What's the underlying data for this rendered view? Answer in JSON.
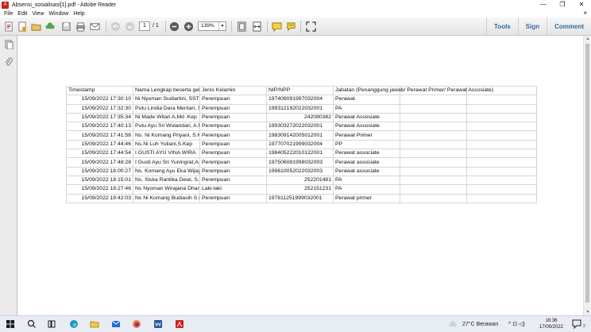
{
  "window": {
    "title": "Absensi_sosialisasi[1].pdf - Adobe Reader",
    "controls": {
      "minimize": "—",
      "maximize": "❐",
      "close": "✕"
    }
  },
  "menu": {
    "items": [
      "File",
      "Edit",
      "View",
      "Window",
      "Help"
    ],
    "close_doc": "×"
  },
  "toolbar": {
    "page_current": "1",
    "page_total": "/ 1",
    "zoom": "139%",
    "nav_links": [
      "Tools",
      "Sign",
      "Comment"
    ]
  },
  "table": {
    "headers": [
      "Timestamp",
      "Nama Lengkap beserta gelar",
      "Jenis Kelamin",
      "NIP/NPP",
      "Jabatan (Penanggung jawab/ Perawat Primer/ Perawat Assosiate)"
    ],
    "rows": [
      [
        "15/09/2022 17:30:10",
        "Ni Nyoman Sudiartini, SST",
        "Perempuan",
        "197409091997032004",
        "Perawat"
      ],
      [
        "15/09/2022 17:32:30",
        "Putu Lindia Dara Mentari, S.Kep",
        "Perempuan",
        "199312192022032001",
        "PA"
      ],
      [
        "15/09/2022 17:35:34",
        "Ni Made Witari A,Md .Kep",
        "Perempuan",
        "242080382",
        "Perawat Assosiate"
      ],
      [
        "15/09/2022 17:40:13",
        "Putu Ayu Sri Wulandari, A.Md.Kep",
        "Perempuan",
        "199303272022032001",
        "Perawat Assosiate"
      ],
      [
        "15/09/2022 17:41:58",
        "Ns. Ni Komang Priyani, S.Kep",
        "Perempuan",
        "198309142005012001",
        "Perawat Primer"
      ],
      [
        "15/09/2022 17:44:46",
        "Ns.Ni Luh Yuliani,S.Kep",
        "Perempuan",
        "197707021999032004",
        "PP"
      ],
      [
        "15/09/2022 17:44:54",
        "I GUSTI AYU VINA WIRA",
        "Perempuan",
        "198405222010122001",
        "Perawat associate"
      ],
      [
        "15/09/2022 17:48:28",
        "I Gusti Ayu Sri Yuningrat,A.Md.Kep",
        "Perempuan",
        "197506081998032003",
        "Perawat assosiate"
      ],
      [
        "15/09/2022 18:00:27",
        "Ns. Komang Ayu Eka Wijaya",
        "Perempuan",
        "199610052022032003",
        "Perawat associate"
      ],
      [
        "15/09/2022 18:15:01",
        "Ns. Siska Rantika Dewi, S.Kep",
        "Perempuan",
        "252201481",
        "PA"
      ],
      [
        "15/09/2022 18:27:46",
        "Ns Nyoman Wirajana Dharma",
        "Laki-laki",
        "252151231",
        "PA"
      ],
      [
        "15/09/2022 19:42:03",
        "Ns Ni Komang Budiasih S.Kep",
        "Perempuan",
        "197811251999032001",
        "Perawat primer"
      ]
    ]
  },
  "taskbar": {
    "weather": "27°C  Berawan",
    "tray_icons": "^  ⊡  ◁)",
    "time": "16:36",
    "date": "17/09/2022",
    "notifications": "2"
  }
}
